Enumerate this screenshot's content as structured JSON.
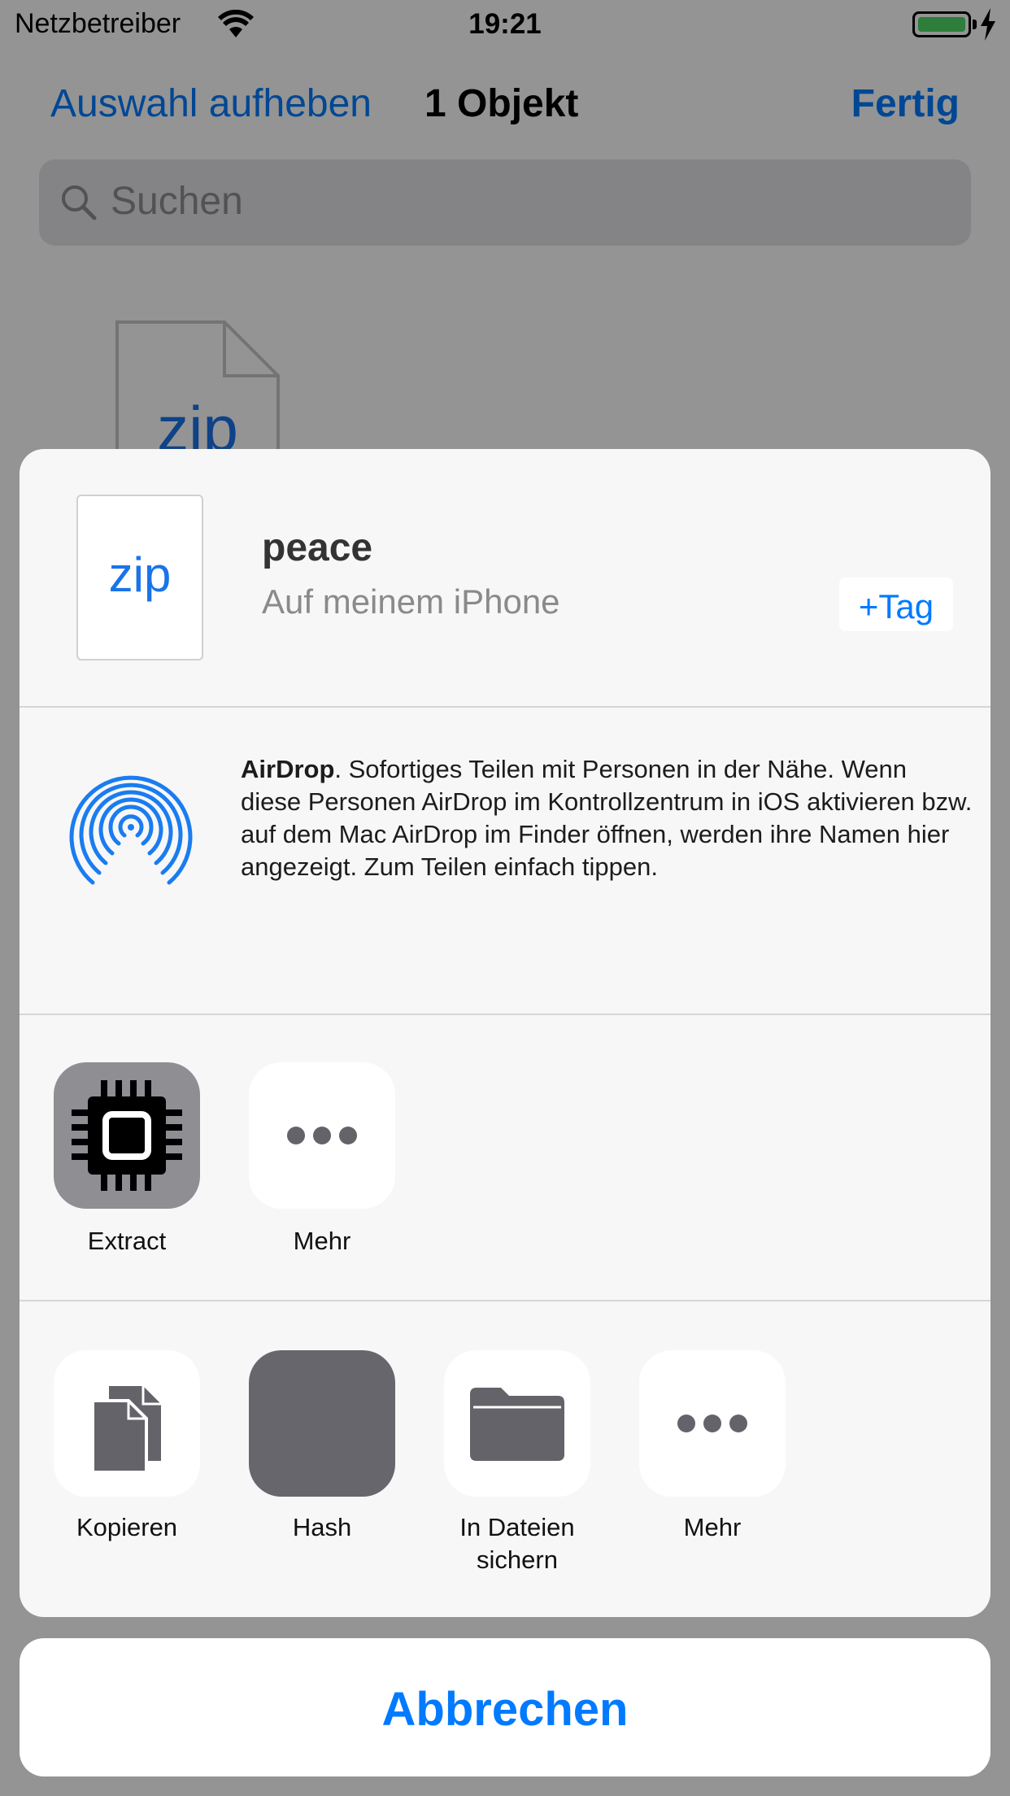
{
  "status_bar": {
    "carrier": "Netzbetreiber",
    "time": "19:21",
    "battery_color": "#4cd964"
  },
  "nav": {
    "left_label": "Auswahl aufheben",
    "title": "1 Objekt",
    "right_label": "Fertig"
  },
  "search": {
    "placeholder": "Suchen"
  },
  "background_file": {
    "type_label": "zip"
  },
  "share_sheet": {
    "file": {
      "thumb_label": "zip",
      "name": "peace",
      "location": "Auf meinem iPhone",
      "tag_button": "+Tag"
    },
    "airdrop": {
      "title": "AirDrop",
      "description": ". Sofortiges Teilen mit Personen in der Nähe. Wenn diese Personen AirDrop im Kontrollzentrum in iOS aktivieren bzw. auf dem Mac AirDrop im Finder öffnen, werden ihre Namen hier angezeigt. Zum Teilen einfach tippen."
    },
    "app_row": [
      {
        "label": "Extract",
        "icon": "chip-icon"
      },
      {
        "label": "Mehr",
        "icon": "more-dots-icon"
      }
    ],
    "action_row": [
      {
        "label": "Kopieren",
        "icon": "copy-icon"
      },
      {
        "label": "Hash",
        "icon": "hash-icon"
      },
      {
        "label": "In Dateien sichern",
        "icon": "folder-icon"
      },
      {
        "label": "Mehr",
        "icon": "more-dots-icon"
      }
    ]
  },
  "cancel_label": "Abbrechen",
  "colors": {
    "accent": "#007aff",
    "sheet_background": "#f7f7f7",
    "airdrop_blue": "#1a7cf0",
    "icon_gray": "#636369"
  }
}
